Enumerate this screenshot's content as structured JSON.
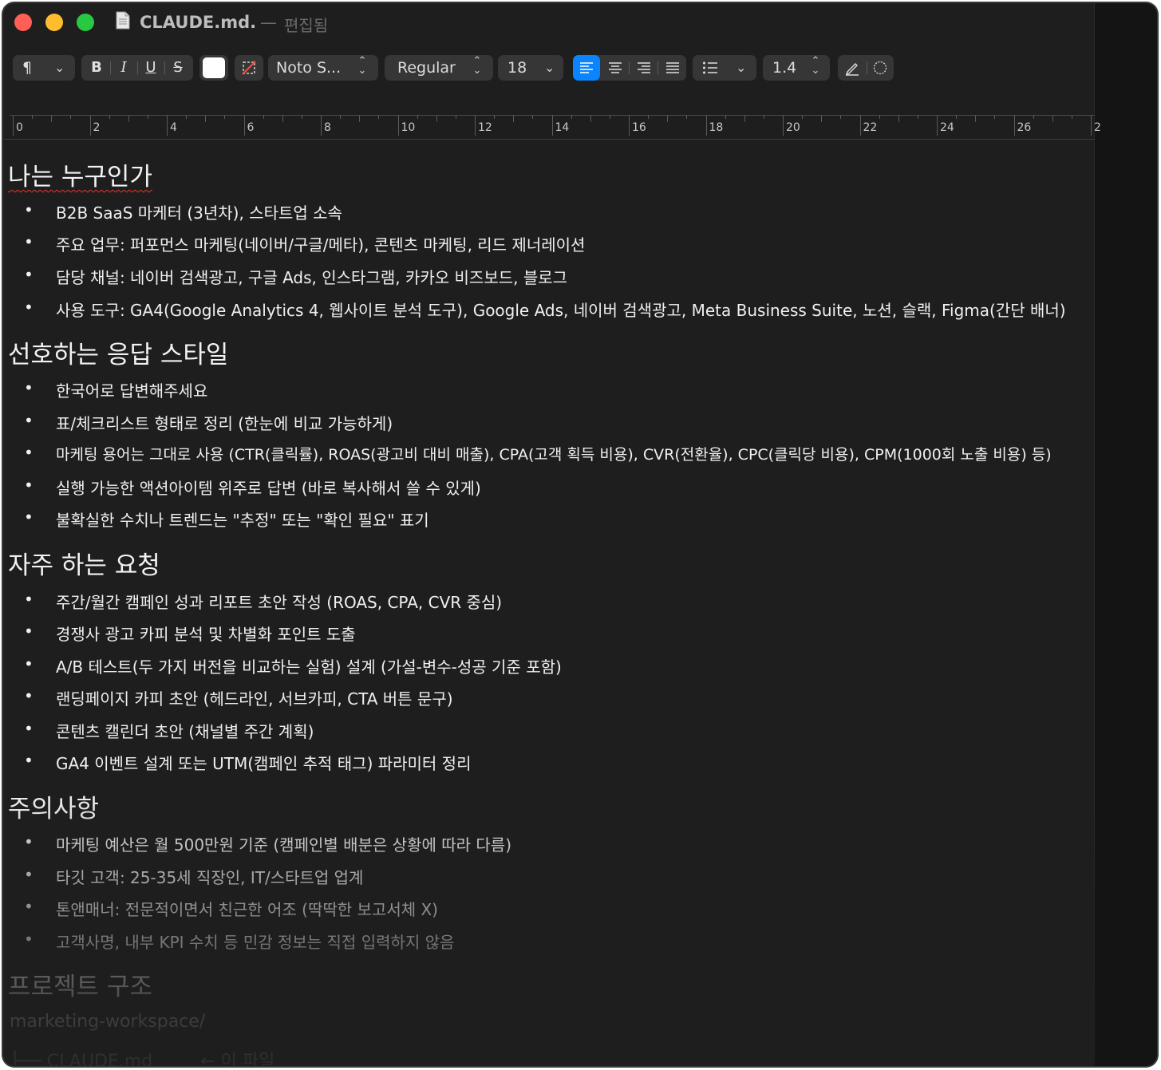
{
  "window": {
    "title": "CLAUDE.md.",
    "separator": "—",
    "status": "편집됨"
  },
  "toolbar": {
    "paragraph_symbol": "¶",
    "bold": "B",
    "italic": "I",
    "underline": "U",
    "strike": "S",
    "font_family": "Noto S...",
    "font_style": "Regular",
    "font_size": "18",
    "line_spacing": "1.4",
    "icons": [
      "paragraph-style-icon",
      "text-color-swatch",
      "highlight-clear-icon",
      "align-left-icon",
      "align-center-icon",
      "align-right-icon",
      "justify-icon",
      "list-icon",
      "pencil-icon",
      "circle-icon"
    ]
  },
  "ruler": {
    "labels": [
      "0",
      "2",
      "4",
      "6",
      "8",
      "10",
      "12",
      "14",
      "16",
      "18",
      "20",
      "22",
      "24",
      "26",
      "2"
    ]
  },
  "document": {
    "sections": [
      {
        "heading": "나는 누구인가",
        "items": [
          "B2B SaaS 마케터 (3년차), 스타트업 소속",
          "주요 업무: 퍼포먼스 마케팅(네이버/구글/메타), 콘텐츠 마케팅, 리드 제너레이션",
          "담당 채널: 네이버 검색광고, 구글 Ads, 인스타그램, 카카오 비즈보드, 블로그",
          "사용 도구: GA4(Google Analytics 4, 웹사이트 분석 도구), Google Ads, 네이버 검색광고, Meta Business Suite, 노션, 슬랙, Figma(간단 배너)"
        ]
      },
      {
        "heading": "선호하는 응답 스타일",
        "items": [
          "한국어로 답변해주세요",
          "표/체크리스트 형태로 정리 (한눈에 비교 가능하게)",
          "마케팅 용어는 그대로 사용 (CTR(클릭률), ROAS(광고비 대비 매출), CPA(고객 획득 비용), CVR(전환율), CPC(클릭당 비용), CPM(1000회 노출 비용) 등)",
          "실행 가능한 액션아이템 위주로 답변 (바로 복사해서 쓸 수 있게)",
          "불확실한 수치나 트렌드는 \"추정\" 또는 \"확인 필요\" 표기"
        ]
      },
      {
        "heading": "자주 하는 요청",
        "items": [
          "주간/월간 캠페인 성과 리포트 초안 작성 (ROAS, CPA, CVR 중심)",
          "경쟁사 광고 카피 분석 및 차별화 포인트 도출",
          "A/B 테스트(두 가지 버전을 비교하는 실험) 설계 (가설-변수-성공 기준 포함)",
          "랜딩페이지 카피 초안 (헤드라인, 서브카피, CTA 버튼 문구)",
          "콘텐츠 캘린더 초안 (채널별 주간 계획)",
          "GA4 이벤트 설계 또는 UTM(캠페인 추적 태그) 파라미터 정리"
        ]
      },
      {
        "heading": "주의사항",
        "items": [
          "마케팅 예산은 월 500만원 기준 (캠페인별 배분은 상황에 따라 다름)",
          "타깃 고객: 25-35세 직장인, IT/스타트업 업계",
          "톤앤매너: 전문적이면서 친근한 어조 (딱딱한 보고서체 X)",
          "고객사명, 내부 KPI 수치 등 민감 정보는 직접 입력하지 않음"
        ]
      },
      {
        "heading": "프로젝트 구조",
        "items": []
      }
    ],
    "tree_root": "marketing-workspace/",
    "tree_line": "├── CLAUDE.md",
    "tree_comment": "← 이 파일",
    "bullet": "•"
  },
  "colors": {
    "background": "#1e1e1e",
    "text": "#f0f0f0",
    "accent_blue": "#0a84ff",
    "traffic_red": "#ff5f57",
    "traffic_yellow": "#febc2e",
    "traffic_green": "#28c840",
    "spellcheck_red": "#e0392d"
  }
}
